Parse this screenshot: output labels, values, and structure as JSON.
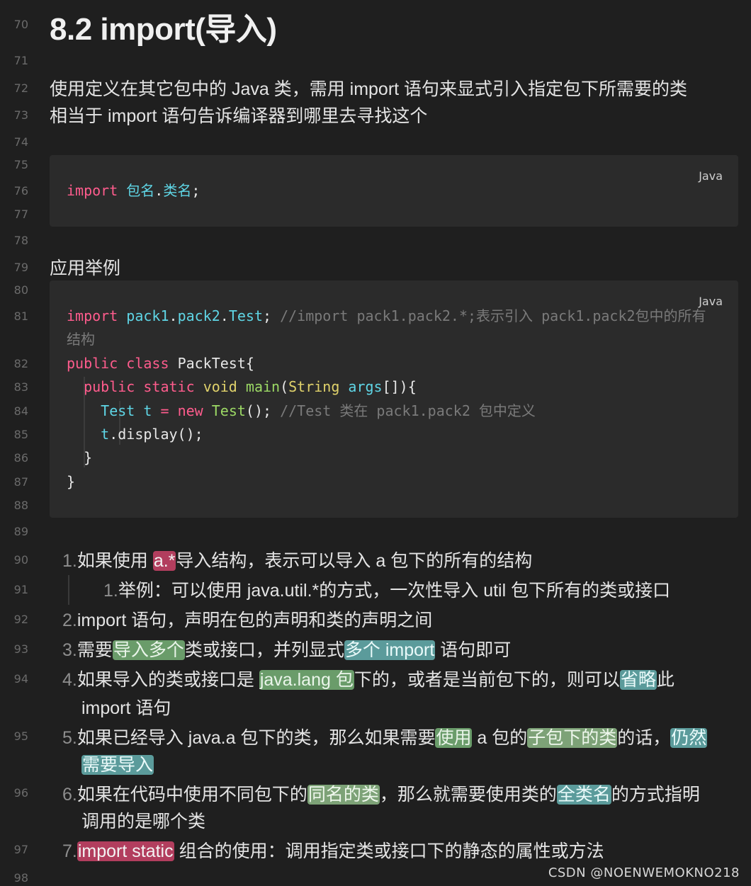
{
  "line_numbers": [
    "70",
    "71",
    "72",
    "73",
    "74",
    "75",
    "76",
    "77",
    "78",
    "79",
    "80",
    "81",
    "82",
    "83",
    "84",
    "85",
    "86",
    "87",
    "88",
    "89",
    "90",
    "91",
    "92",
    "93",
    "94",
    "95",
    "96",
    "97",
    "98"
  ],
  "title": "8.2 import(导入)",
  "intro": {
    "line1": "使用定义在其它包中的 Java 类，需用 import 语句来显式引入指定包下所需要的类",
    "line2": "相当于 import 语句告诉编译器到哪里去寻找这个"
  },
  "code1": {
    "lang": "Java",
    "tok": [
      "import",
      "包名",
      ".",
      "类名",
      ";"
    ]
  },
  "example_heading": "应用举例",
  "code2": {
    "lang": "Java",
    "l1": [
      "import",
      "pack1",
      ".",
      "pack2",
      ".",
      "Test",
      ";",
      "//import pack1.pack2.*;表示引入 pack1.pack2包中的所有"
    ],
    "l1b": "结构",
    "l2": [
      "public",
      "class",
      "PackTest{"
    ],
    "l3": [
      "public",
      "static",
      "void",
      "main",
      "(",
      "String",
      "args",
      "[]){"
    ],
    "l4": [
      "Test",
      "t",
      "=",
      "new",
      "Test",
      "();",
      "//Test 类在 pack1.pack2 包中定义"
    ],
    "l5": [
      "t",
      ".display();"
    ],
    "l6": "}",
    "l7": "}"
  },
  "list": {
    "i1": {
      "n": "1.",
      "a": "如果使用 ",
      "h": "a.*",
      "b": "导入结构，表示可以导入 a 包下的所有的结构"
    },
    "i1_1": {
      "n": "1.",
      "t": "举例：可以使用 java.util.*的方式，一次性导入 util 包下所有的类或接口"
    },
    "i2": {
      "n": "2.",
      "t": "import 语句，声明在包的声明和类的声明之间"
    },
    "i3": {
      "n": "3.",
      "a": "需要",
      "h1": "导入多个",
      "b": "类或接口，并列显式",
      "h2": "多个 import",
      "c": " 语句即可"
    },
    "i4": {
      "n": "4.",
      "a": "如果导入的类或接口是 ",
      "h1": "java.lang 包",
      "b": "下的，或者是当前包下的，则可以",
      "h2": "省略",
      "c": "此",
      "d": "import 语句"
    },
    "i5": {
      "n": "5.",
      "a": "如果已经导入 java.a 包下的类，那么如果需要",
      "h1": "使用",
      "b": " a 包的",
      "h2": "子包下的类",
      "c": "的话，",
      "h3": "仍然",
      "h4": "需要导入"
    },
    "i6": {
      "n": "6.",
      "a": "如果在代码中使用不同包下的",
      "h1": "同名的类",
      "b": "，那么就需要使用类的",
      "h2": "全类名",
      "c": "的方式指明",
      "d": "调用的是哪个类"
    },
    "i7": {
      "n": "7.",
      "h": "import static",
      "a": " 组合的使用：调用指定类或接口下的静态的属性或方法"
    }
  },
  "watermark": "CSDN @NOENWEMOKNO218"
}
